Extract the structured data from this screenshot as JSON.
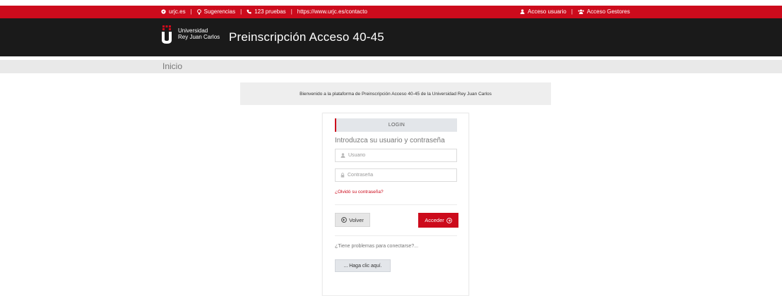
{
  "topbar": {
    "links": [
      {
        "icon": "location-icon",
        "label": "urjc.es"
      },
      {
        "icon": "lightbulb-icon",
        "label": "Sugerencias"
      },
      {
        "icon": "phone-icon",
        "label": "123 pruebas"
      },
      {
        "icon": "",
        "label": "https://www.urjc.es/contacto"
      }
    ],
    "user_access": {
      "icon": "user-icon",
      "label": "Acceso usuario"
    },
    "managers_access": {
      "icon": "group-icon",
      "label": "Acceso Gestores"
    },
    "separator": "|"
  },
  "header": {
    "logo_line1": "Universidad",
    "logo_line2": "Rey Juan Carlos",
    "title": "Preinscripción Acceso 40-45"
  },
  "breadcrumb": {
    "label": "Inicio"
  },
  "welcome": {
    "text": "Bienvenido a la plataforma de Preinscripción Acceso 40-45 de la Universidad Rey Juan Carlos"
  },
  "login": {
    "tab_label": "LOGIN",
    "subtitle": "Introduzca su usuario y contraseña",
    "username_placeholder": "Usuario",
    "password_placeholder": "Contraseña",
    "forgot_label": "¿Olvidó su contraseña?",
    "back_label": "Volver",
    "submit_label": "Acceder",
    "problems_text": "¿Tiene problemas para conectarse?...",
    "click_here_label": "... Haga clic aquí."
  },
  "colors": {
    "brand_red": "#cc0b1c",
    "header_dark": "#1a1a1a",
    "breadcrumb_bg": "#e9e9e9"
  }
}
